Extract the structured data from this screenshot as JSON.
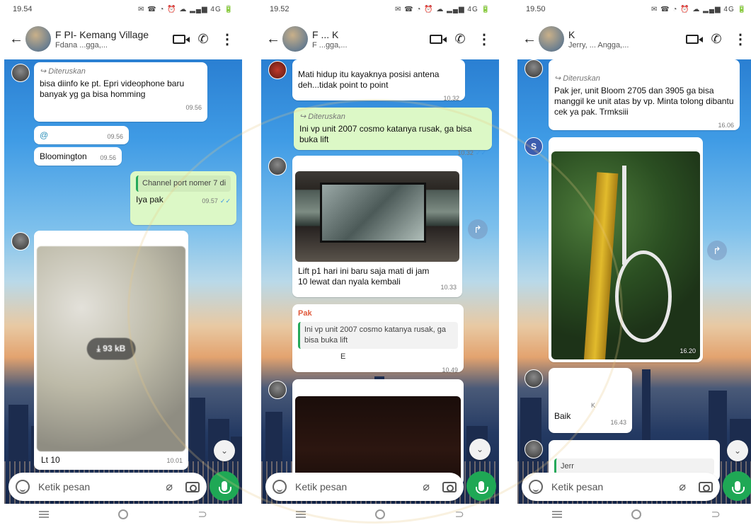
{
  "screens": [
    {
      "status": {
        "time": "19.54",
        "icons": "✉ ☎  ◔ ⏰ ☁ ▂▄▆ 4G 🔋"
      },
      "header": {
        "title": "F PI- Kemang Village",
        "subtitle": "Fdana ...gga,..."
      },
      "messages": {
        "m1": {
          "forward_label": "Diteruskan",
          "text": "bisa diinfo ke pt. Epri videophone baru banyak yg ga bisa homming",
          "time": "09.56"
        },
        "m2": {
          "text": "@",
          "time": "09.56"
        },
        "m3": {
          "text": "Bloomington",
          "time": "09.56"
        },
        "m4": {
          "quote": "Channel port nomer 7 di",
          "text": "Iya pak",
          "time": "09.57",
          "tick": "✓✓"
        },
        "m5": {
          "download_size": "93 kB",
          "caption": "Lt 10",
          "time": "10.01"
        }
      },
      "scroll_icon": "chevron-double-down-icon"
    },
    {
      "status": {
        "time": "19.52",
        "icons": "✉ ☎  ◔ ⏰ ☁ ▂▄▆ 4G 🔋"
      },
      "header": {
        "title": "F ... K",
        "subtitle": "F ...gga,..."
      },
      "messages": {
        "m1": {
          "text": "Mati hidup itu kayaknya posisi antena deh...tidak point to point",
          "time": "10.32"
        },
        "m2": {
          "forward_label": "Diteruskan",
          "text": "Ini vp unit 2007 cosmo katanya rusak, ga bisa buka lift",
          "time": "10.32",
          "tick": "✓✓"
        },
        "m3": {
          "text": "Lift p1 hari ini baru saja mati di jam 10 lewat dan nyala kembali",
          "time": "10.33"
        },
        "m4": {
          "sender": "Pak",
          "quote": "Ini vp unit 2007 cosmo katanya rusak, ga bisa buka lift",
          "text": "E",
          "time": "10.49"
        }
      },
      "scroll_icon": "chevron-double-down-icon"
    },
    {
      "status": {
        "time": "19.50",
        "icons": "✉ ☎  ◔ ⏰ ☁ ▂▄▆ 4G 🔋"
      },
      "header": {
        "title": "K",
        "subtitle": "Jerry, ... Angga,..."
      },
      "messages": {
        "m1": {
          "forward_label": "Diteruskan",
          "text": "Pak jer, unit Bloom 2705 dan 3905 ga bisa manggil ke unit atas by vp. Minta tolong dibantu cek ya pak. Trmksiii",
          "time": "16.06"
        },
        "m2": {
          "avatar_letter": "S",
          "time": "16.20"
        },
        "m3": {
          "sender": "K",
          "text": "Baik",
          "time": "16.43"
        },
        "m4": {
          "quote": "Jerr"
        }
      },
      "scroll_icon": "chevron-double-down-icon"
    }
  ],
  "composer": {
    "placeholder": "Ketik pesan"
  },
  "nav": {
    "menu": "☰",
    "home": "○",
    "back": "⊃"
  }
}
